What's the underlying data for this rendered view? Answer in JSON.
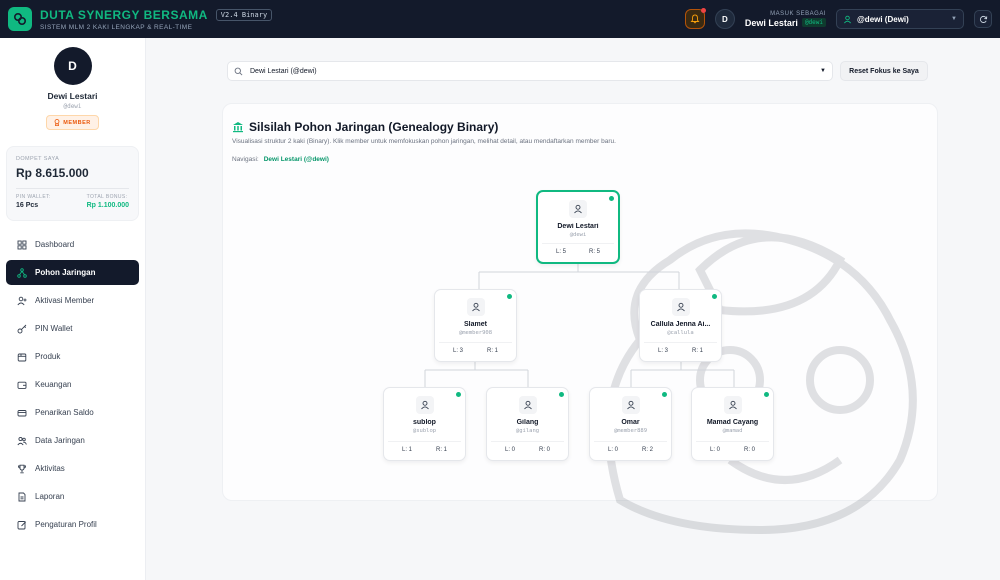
{
  "app": {
    "title": "DUTA SYNERGY BERSAMA",
    "version": "V2.4 Binary",
    "subtitle": "SISTEM MLM 2 KAKI LENGKAP & REAL-TIME"
  },
  "header": {
    "login_label": "MASUK SEBAGAI",
    "login_name": "Dewi Lestari",
    "login_badge": "@dewi",
    "avatar_initial": "D",
    "account_select": "@dewi (Dewi)"
  },
  "profile": {
    "initial": "D",
    "name": "Dewi Lestari",
    "username": "@dewi",
    "role": "MEMBER"
  },
  "wallet": {
    "label": "DOMPET SAYA",
    "amount": "Rp 8.615.000",
    "pin_label": "PIN WALLET:",
    "pin_value": "16 Pcs",
    "bonus_label": "TOTAL BONUS:",
    "bonus_value": "Rp 1.100.000"
  },
  "menu": [
    {
      "label": "Dashboard",
      "icon": "dashboard-icon"
    },
    {
      "label": "Pohon Jaringan",
      "icon": "network-tree-icon"
    },
    {
      "label": "Aktivasi Member",
      "icon": "user-plus-icon"
    },
    {
      "label": "PIN Wallet",
      "icon": "key-icon"
    },
    {
      "label": "Produk",
      "icon": "package-icon"
    },
    {
      "label": "Keuangan",
      "icon": "wallet-icon"
    },
    {
      "label": "Penarikan Saldo",
      "icon": "withdraw-icon"
    },
    {
      "label": "Data Jaringan",
      "icon": "users-icon"
    },
    {
      "label": "Aktivitas",
      "icon": "trophy-icon"
    },
    {
      "label": "Laporan",
      "icon": "report-icon"
    },
    {
      "label": "Pengaturan Profil",
      "icon": "edit-icon"
    }
  ],
  "search": {
    "value": "Dewi Lestari (@dewi)",
    "reset_label": "Reset Fokus ke Saya"
  },
  "tree_card": {
    "title": "Silsilah Pohon Jaringan (Genealogy Binary)",
    "subtitle": "Visualisasi struktur 2 kaki (Binary). Klik member untuk memfokuskan pohon jaringan, melihat detail, atau mendaftarkan member baru.",
    "nav_label": "Navigasi:",
    "nav_link": "Dewi Lestari (@dewi)"
  },
  "nodes": [
    {
      "name": "Dewi Lestari",
      "user": "@dewi",
      "l": "L: 5",
      "r": "R: 5"
    },
    {
      "name": "Slamet",
      "user": "@member908",
      "l": "L: 3",
      "r": "R: 1"
    },
    {
      "name": "Callula Jenna Ai...",
      "user": "@callula",
      "l": "L: 3",
      "r": "R: 1"
    },
    {
      "name": "sublop",
      "user": "@sublop",
      "l": "L: 1",
      "r": "R: 1"
    },
    {
      "name": "Gilang",
      "user": "@gilang",
      "l": "L: 0",
      "r": "R: 0"
    },
    {
      "name": "Omar",
      "user": "@member889",
      "l": "L: 0",
      "r": "R: 2"
    },
    {
      "name": "Mamad Cayang",
      "user": "@mamad",
      "l": "L: 0",
      "r": "R: 0"
    }
  ],
  "colors": {
    "accent": "#10b981",
    "dark": "#131a2b"
  }
}
